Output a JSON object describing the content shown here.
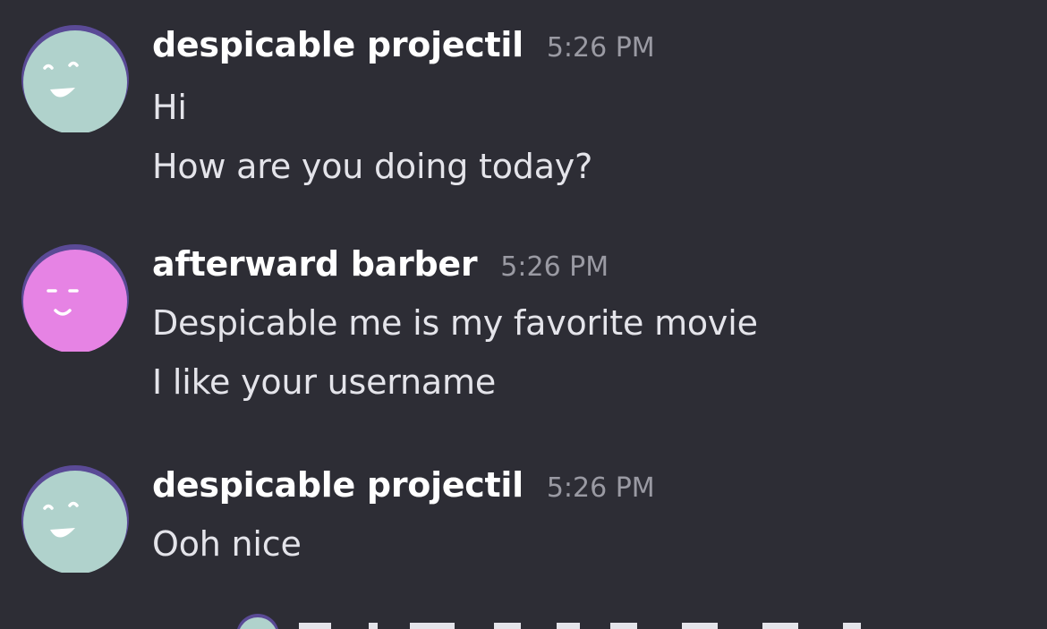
{
  "messages": [
    {
      "username": "despicable projectil",
      "time": "5:26 PM",
      "avatar_color": "#b0d2cc",
      "avatar_ring": "#5a4a96",
      "avatar_icon": "smiley-icon",
      "lines": [
        "Hi",
        "How are you doing today?"
      ]
    },
    {
      "username": "afterward barber",
      "time": "5:26 PM",
      "avatar_color": "#e683e4",
      "avatar_ring": "#5a4a96",
      "avatar_icon": "smiley-icon",
      "lines": [
        "Despicable me is my favorite movie",
        "I like your username"
      ]
    },
    {
      "username": "despicable projectil",
      "time": "5:26 PM",
      "avatar_color": "#b0d2cc",
      "avatar_ring": "#5a4a96",
      "avatar_icon": "smiley-icon",
      "lines": [
        "Ooh nice"
      ]
    }
  ],
  "colors": {
    "background": "#2d2d35",
    "username": "#ffffff",
    "timestamp": "#9a9aa3",
    "message_text": "#e4e4ea"
  }
}
